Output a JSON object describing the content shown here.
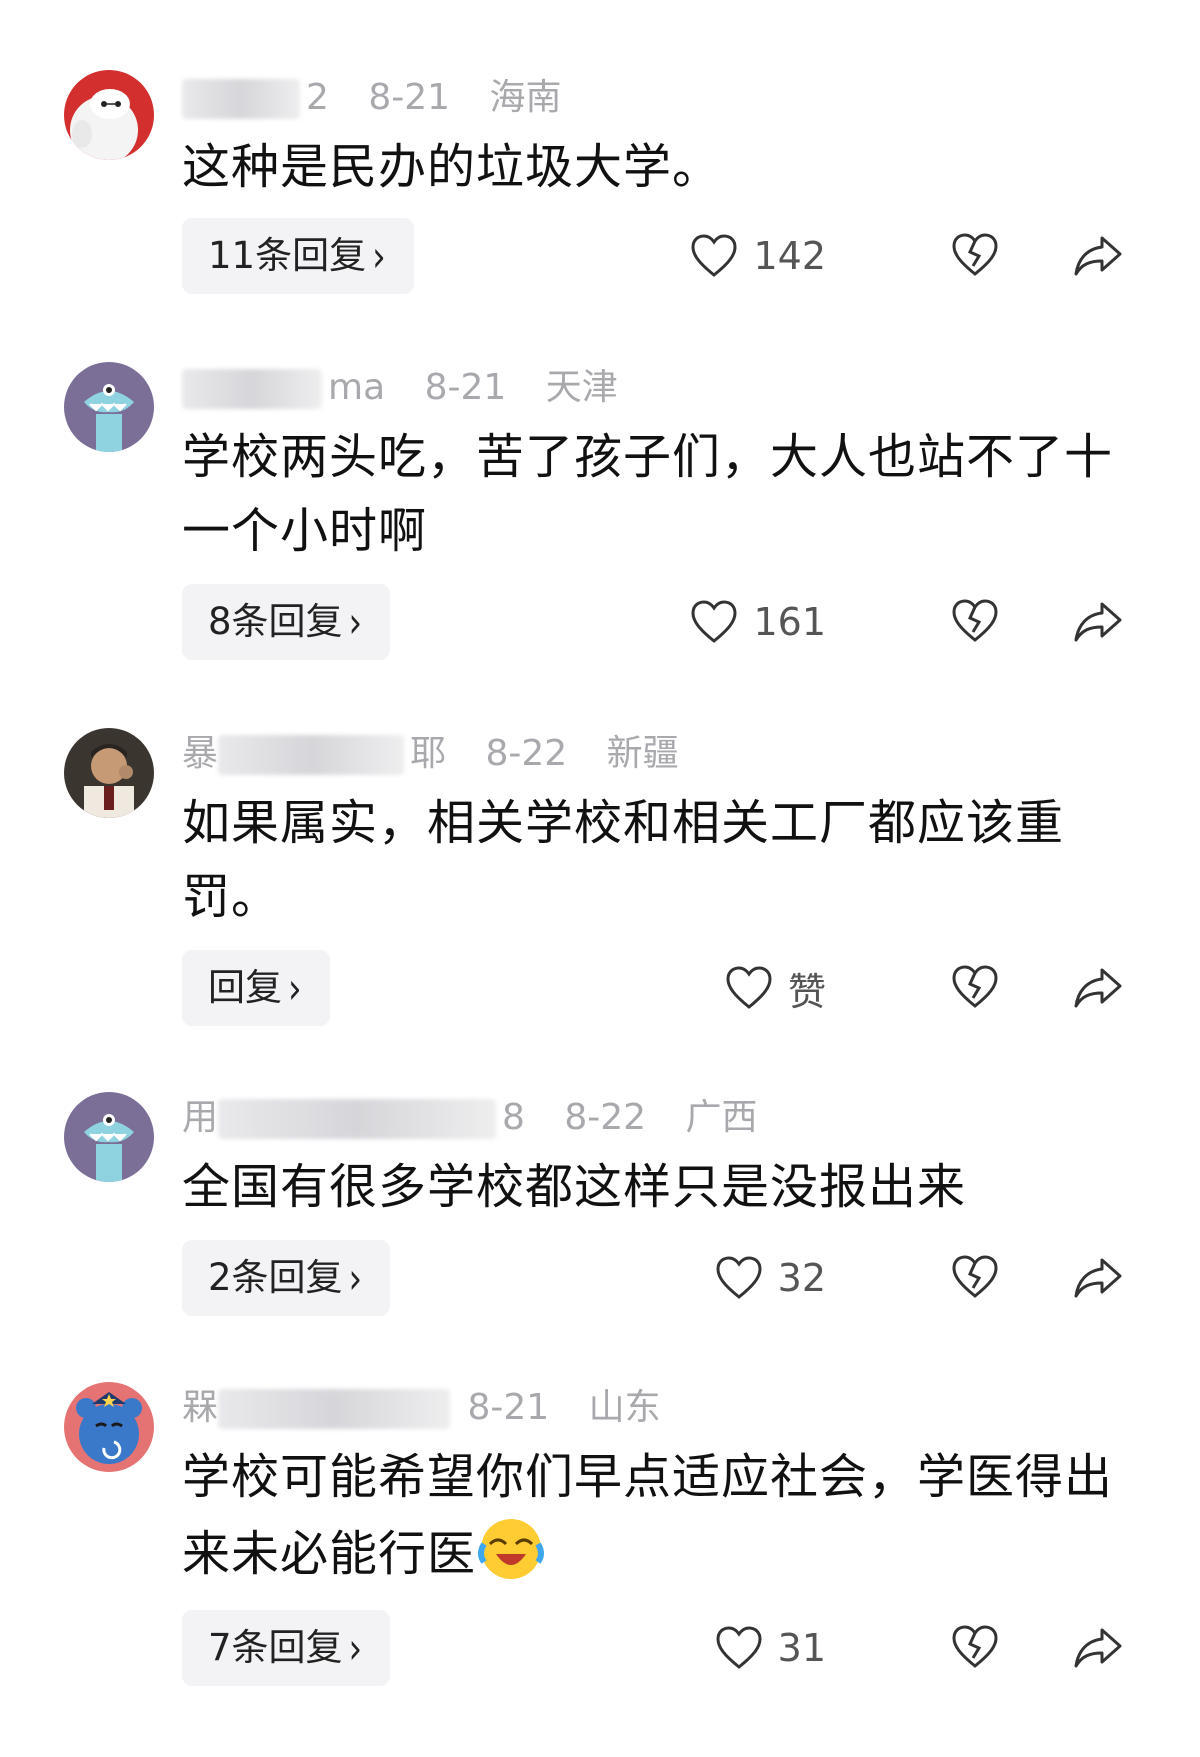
{
  "comments": [
    {
      "user_visible": "2",
      "date": "8-21",
      "location": "海南",
      "text": "这种是民办的垃圾大学。",
      "reply_label": "11条回复",
      "like_count": "142"
    },
    {
      "user_visible": "ma",
      "date": "8-21",
      "location": "天津",
      "text": "学校两头吃，苦了孩子们，大人也站不了十一个小时啊",
      "reply_label": "8条回复",
      "like_count": "161"
    },
    {
      "user_visible_a": "暴",
      "user_visible_b": "耶",
      "date": "8-22",
      "location": "新疆",
      "text": "如果属实，相关学校和相关工厂都应该重罚。",
      "reply_label": "回复",
      "like_count": "赞"
    },
    {
      "user_visible_a": "用",
      "user_visible_b": "8",
      "date": "8-22",
      "location": "广西",
      "text": "全国有很多学校都这样只是没报出来",
      "reply_label": "2条回复",
      "like_count": "32"
    },
    {
      "user_visible": "槑",
      "date": "8-21",
      "location": "山东",
      "text": "学校可能希望你们早点适应社会，学医得出来未必能行医",
      "reply_label": "7条回复",
      "like_count": "31"
    }
  ],
  "chevron": "›",
  "icons": [
    "heart-outline-icon",
    "broken-heart-icon",
    "share-arrow-icon",
    "laughing-crying-emoji"
  ]
}
